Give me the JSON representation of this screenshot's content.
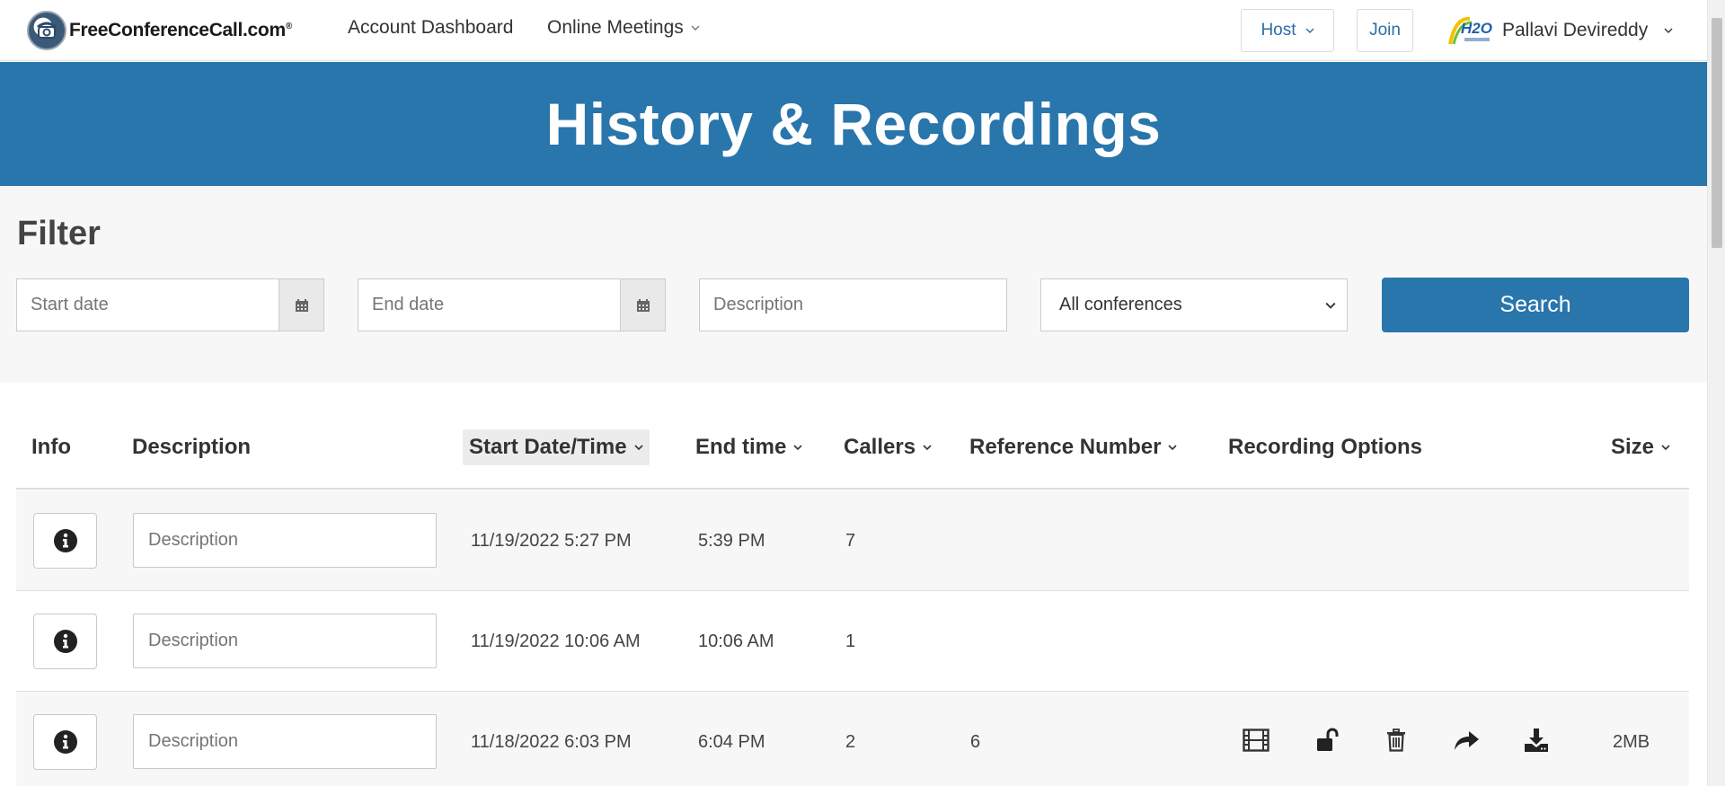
{
  "nav": {
    "logo_text": "FreeConferenceCall.com",
    "logo_reg": "®",
    "account_dashboard": "Account Dashboard",
    "online_meetings": "Online Meetings",
    "host": "Host",
    "join": "Join",
    "user_name": "Pallavi Devireddy",
    "avatar_text": "H2O"
  },
  "banner": {
    "title": "History & Recordings"
  },
  "filter": {
    "title": "Filter",
    "start_date_placeholder": "Start date",
    "end_date_placeholder": "End date",
    "description_placeholder": "Description",
    "conference_selected": "All conferences",
    "search_label": "Search"
  },
  "table": {
    "headers": {
      "info": "Info",
      "description": "Description",
      "start": "Start Date/Time",
      "end": "End time",
      "callers": "Callers",
      "reference": "Reference Number",
      "recording": "Recording Options",
      "size": "Size"
    },
    "description_placeholder": "Description",
    "rows": [
      {
        "start": "11/19/2022 5:27 PM",
        "end": "5:39 PM",
        "callers": "7",
        "reference": "",
        "size": "",
        "has_recording": false
      },
      {
        "start": "11/19/2022 10:06 AM",
        "end": "10:06 AM",
        "callers": "1",
        "reference": "",
        "size": "",
        "has_recording": false
      },
      {
        "start": "11/18/2022 6:03 PM",
        "end": "6:04 PM",
        "callers": "2",
        "reference": "6",
        "size": "2MB",
        "has_recording": true
      }
    ]
  },
  "icons": {
    "info": "info-circle-icon",
    "calendar": "calendar-icon",
    "video": "film-icon",
    "lock": "unlock-icon",
    "trash": "trash-icon",
    "share": "share-icon",
    "download": "download-icon"
  },
  "colors": {
    "brand_blue": "#2876ac",
    "link_blue": "#2a6ea6"
  }
}
